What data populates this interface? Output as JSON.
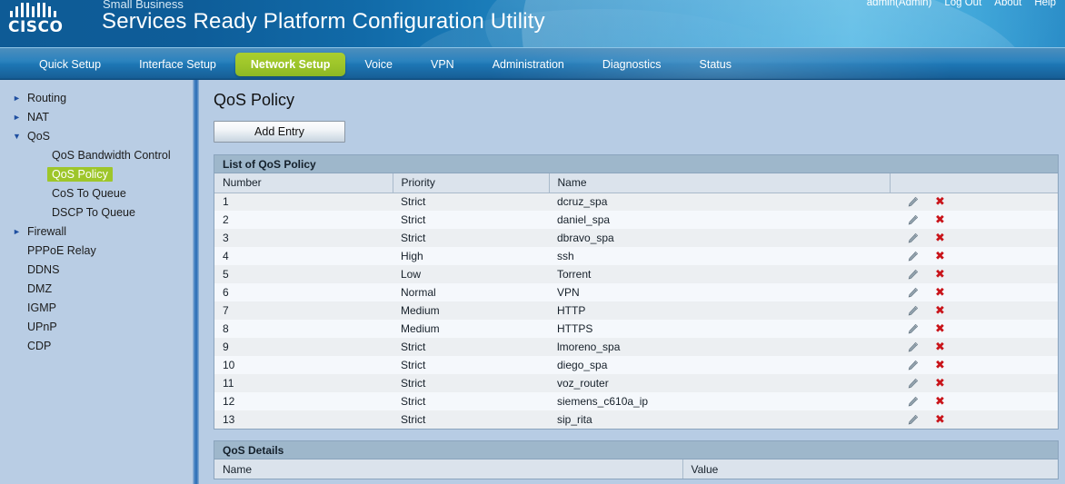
{
  "header": {
    "brand_small": "Small Business",
    "brand_main": "Services Ready Platform Configuration Utility",
    "logo_text": "CISCO",
    "links": [
      {
        "label": "admin(Admin)"
      },
      {
        "label": "Log Out"
      },
      {
        "label": "About"
      },
      {
        "label": "Help"
      }
    ]
  },
  "nav": {
    "tabs": [
      {
        "label": "Quick Setup",
        "active": false
      },
      {
        "label": "Interface Setup",
        "active": false
      },
      {
        "label": "Network Setup",
        "active": true
      },
      {
        "label": "Voice",
        "active": false
      },
      {
        "label": "VPN",
        "active": false
      },
      {
        "label": "Administration",
        "active": false
      },
      {
        "label": "Diagnostics",
        "active": false
      },
      {
        "label": "Status",
        "active": false
      }
    ],
    "active_tab": "Network Setup",
    "accent_green": "#9ec62a"
  },
  "sidebar": {
    "items": [
      {
        "label": "Routing",
        "arrow": "collapsed",
        "child": false,
        "selected": false
      },
      {
        "label": "NAT",
        "arrow": "collapsed",
        "child": false,
        "selected": false
      },
      {
        "label": "QoS",
        "arrow": "expanded",
        "child": false,
        "selected": false
      },
      {
        "label": "QoS Bandwidth Control",
        "arrow": "none",
        "child": true,
        "selected": false
      },
      {
        "label": "QoS Policy",
        "arrow": "none",
        "child": true,
        "selected": true
      },
      {
        "label": "CoS To Queue",
        "arrow": "none",
        "child": true,
        "selected": false
      },
      {
        "label": "DSCP To Queue",
        "arrow": "none",
        "child": true,
        "selected": false
      },
      {
        "label": "Firewall",
        "arrow": "collapsed",
        "child": false,
        "selected": false
      },
      {
        "label": "PPPoE Relay",
        "arrow": "none",
        "child": false,
        "selected": false
      },
      {
        "label": "DDNS",
        "arrow": "none",
        "child": false,
        "selected": false
      },
      {
        "label": "DMZ",
        "arrow": "none",
        "child": false,
        "selected": false
      },
      {
        "label": "IGMP",
        "arrow": "none",
        "child": false,
        "selected": false
      },
      {
        "label": "UPnP",
        "arrow": "none",
        "child": false,
        "selected": false
      },
      {
        "label": "CDP",
        "arrow": "none",
        "child": false,
        "selected": false
      }
    ]
  },
  "main": {
    "page_title": "QoS Policy",
    "add_entry_label": "Add Entry",
    "list_panel_title": "List of QoS Policy",
    "columns": [
      "Number",
      "Priority",
      "Name",
      ""
    ],
    "rows": [
      {
        "number": "1",
        "priority": "Strict",
        "name": "dcruz_spa"
      },
      {
        "number": "2",
        "priority": "Strict",
        "name": "daniel_spa"
      },
      {
        "number": "3",
        "priority": "Strict",
        "name": "dbravo_spa"
      },
      {
        "number": "4",
        "priority": "High",
        "name": "ssh"
      },
      {
        "number": "5",
        "priority": "Low",
        "name": "Torrent"
      },
      {
        "number": "6",
        "priority": "Normal",
        "name": "VPN"
      },
      {
        "number": "7",
        "priority": "Medium",
        "name": "HTTP"
      },
      {
        "number": "8",
        "priority": "Medium",
        "name": "HTTPS"
      },
      {
        "number": "9",
        "priority": "Strict",
        "name": "lmoreno_spa"
      },
      {
        "number": "10",
        "priority": "Strict",
        "name": "diego_spa"
      },
      {
        "number": "11",
        "priority": "Strict",
        "name": "voz_router"
      },
      {
        "number": "12",
        "priority": "Strict",
        "name": "siemens_c610a_ip"
      },
      {
        "number": "13",
        "priority": "Strict",
        "name": "sip_rita"
      }
    ],
    "row_actions": {
      "edit_icon": "pencil-icon",
      "delete_icon": "delete-x-icon"
    },
    "details_panel_title": "QoS Details",
    "details_columns": [
      "Name",
      "Value"
    ]
  }
}
